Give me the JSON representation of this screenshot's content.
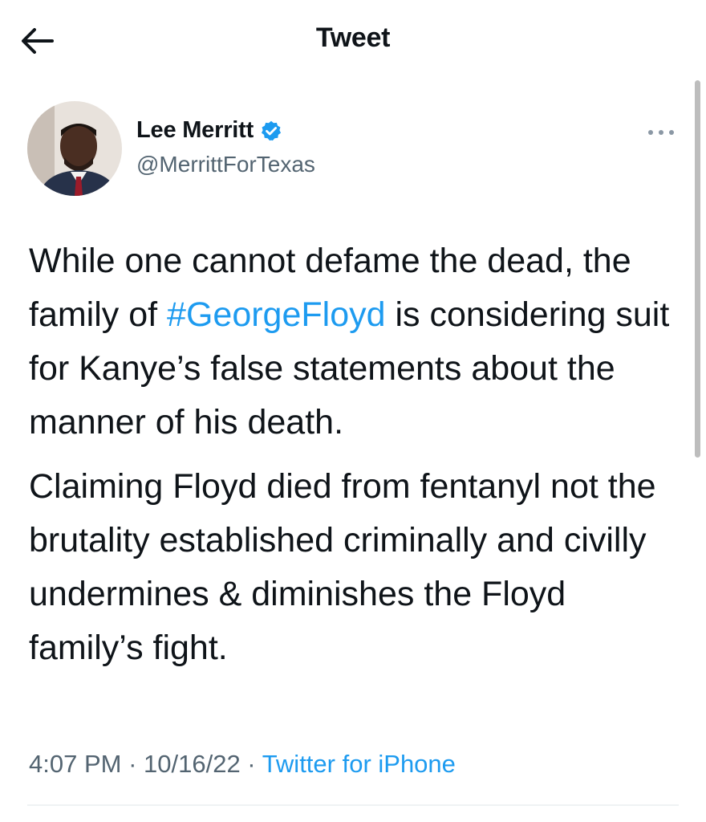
{
  "header": {
    "title": "Tweet",
    "back_icon": "arrow-left-icon"
  },
  "author": {
    "display_name": "Lee Merritt",
    "handle": "@MerrittForTexas",
    "verified_icon": "verified-badge-icon",
    "avatar_icon": "avatar"
  },
  "tweet": {
    "paragraph1": {
      "before": "While one cannot defame the dead, the family of ",
      "hashtag": "#GeorgeFloyd",
      "after": " is considering suit for Kanye’s false statements about the manner of his death."
    },
    "paragraph2": "Claiming Floyd died from fentanyl not the brutality established criminally and civilly undermines & diminishes the Floyd family’s fight."
  },
  "meta": {
    "time": "4:07 PM",
    "separator1": " · ",
    "date": "10/16/22",
    "separator2": " · ",
    "source": "Twitter for iPhone"
  },
  "colors": {
    "link": "#1d9bf0",
    "text": "#0f1419",
    "secondary": "#536471"
  }
}
